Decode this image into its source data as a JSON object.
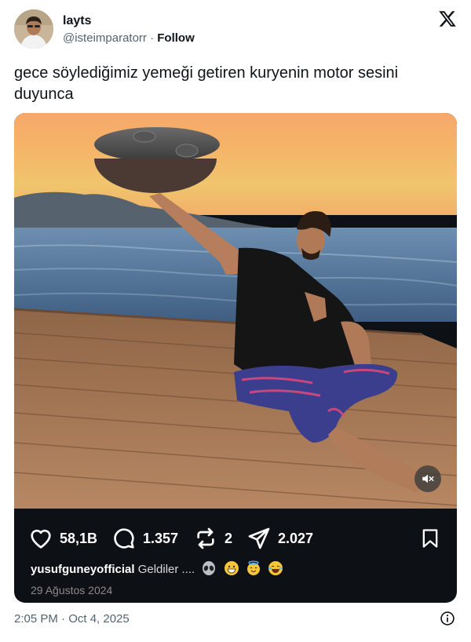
{
  "author": {
    "name": "layts",
    "handle": "@isteimparatorr",
    "separator": "·",
    "follow_label": "Follow"
  },
  "tweet": {
    "text": "gece söylediğimiz yemeği getiren kuryenin motor sesini duyunca"
  },
  "media": {
    "icon": "volume-mute-icon",
    "stats": {
      "likes": "58,1B",
      "comments": "1.357",
      "reposts": "2",
      "shares": "2.027"
    },
    "caption": {
      "user": "yusufguneyofficial",
      "text": "Geldiler ....",
      "emojis": [
        "alien-emoji",
        "grin-emoji",
        "halo-emoji",
        "laughing-tears-emoji"
      ]
    },
    "date": "29 Ağustos 2024"
  },
  "footer": {
    "timestamp": "2:05 PM · Oct 4, 2025"
  },
  "colors": {
    "text": "#0f1419",
    "secondary": "#536471",
    "card_bg": "#0d1116"
  }
}
